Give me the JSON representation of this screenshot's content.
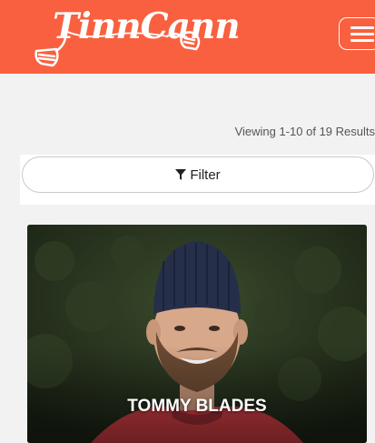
{
  "header": {
    "brand": "TinnCann",
    "background_color": "#f9603f",
    "menu_icon": "hamburger-icon"
  },
  "results": {
    "summary": "Viewing 1-10 of 19 Results"
  },
  "filter": {
    "label": "Filter",
    "icon": "funnel-icon"
  },
  "cards": [
    {
      "name": "TOMMY BLADES"
    }
  ]
}
